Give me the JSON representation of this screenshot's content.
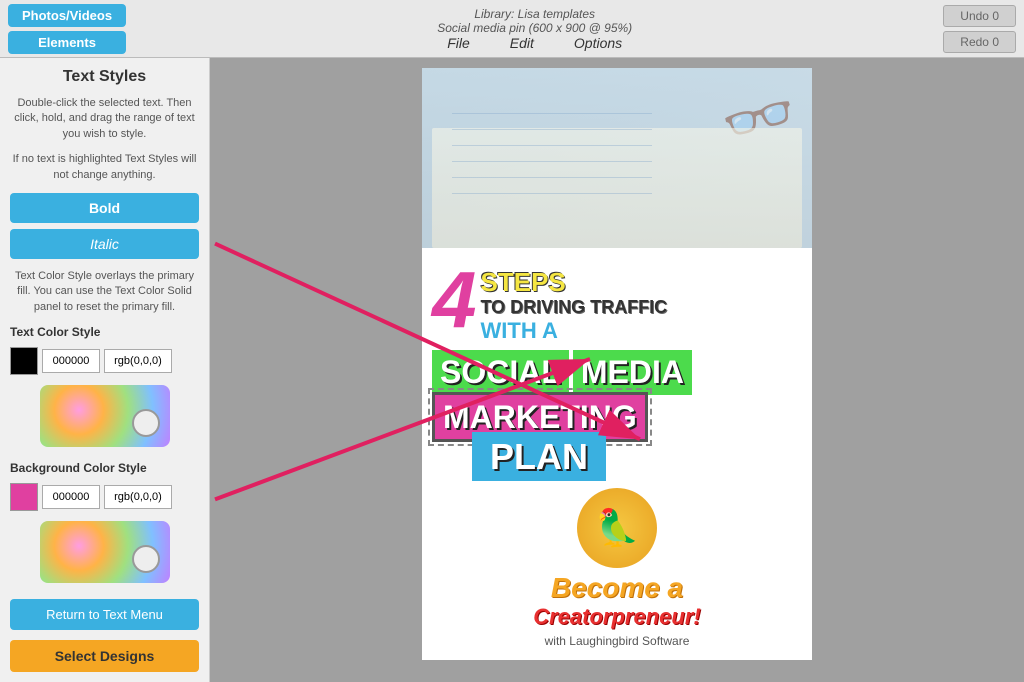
{
  "topbar": {
    "photos_videos_label": "Photos/Videos",
    "elements_label": "Elements",
    "library_info": "Library: Lisa templates",
    "social_media_info": "Social media pin (600 x 900 @ 95%)",
    "file_label": "File",
    "edit_label": "Edit",
    "options_label": "Options",
    "undo_label": "Undo 0",
    "redo_label": "Redo 0"
  },
  "sidebar": {
    "title": "Text Styles",
    "description": "Double-click the selected text. Then click, hold, and drag the range of text you wish to style.",
    "if_no_text": "If no text is highlighted Text Styles will not change anything.",
    "bold_label": "Bold",
    "italic_label": "Italic",
    "text_color_overlay_desc": "Text Color Style overlays the primary fill. You can use the Text Color Solid panel to reset the primary fill.",
    "text_color_style_label": "Text Color Style",
    "text_color_hex": "000000",
    "text_color_rgb": "rgb(0,0,0)",
    "bg_color_style_label": "Background Color Style",
    "bg_color_hex": "000000",
    "bg_color_rgb": "rgb(0,0,0)",
    "return_label": "Return to Text Menu",
    "select_designs_label": "Select Designs"
  },
  "canvas": {
    "number": "4",
    "steps": "STEPS",
    "to_driving_traffic": "TO DRIVING TRAFFIC",
    "with_a": "WITH A",
    "social": "SOCIAL",
    "media": "MEDIA",
    "marketing": "MARKETING",
    "plan": "PLAN",
    "become": "Become a",
    "creatorpreneur": "Creatorpreneur!",
    "with_laughingbird": "with Laughingbird Software"
  }
}
